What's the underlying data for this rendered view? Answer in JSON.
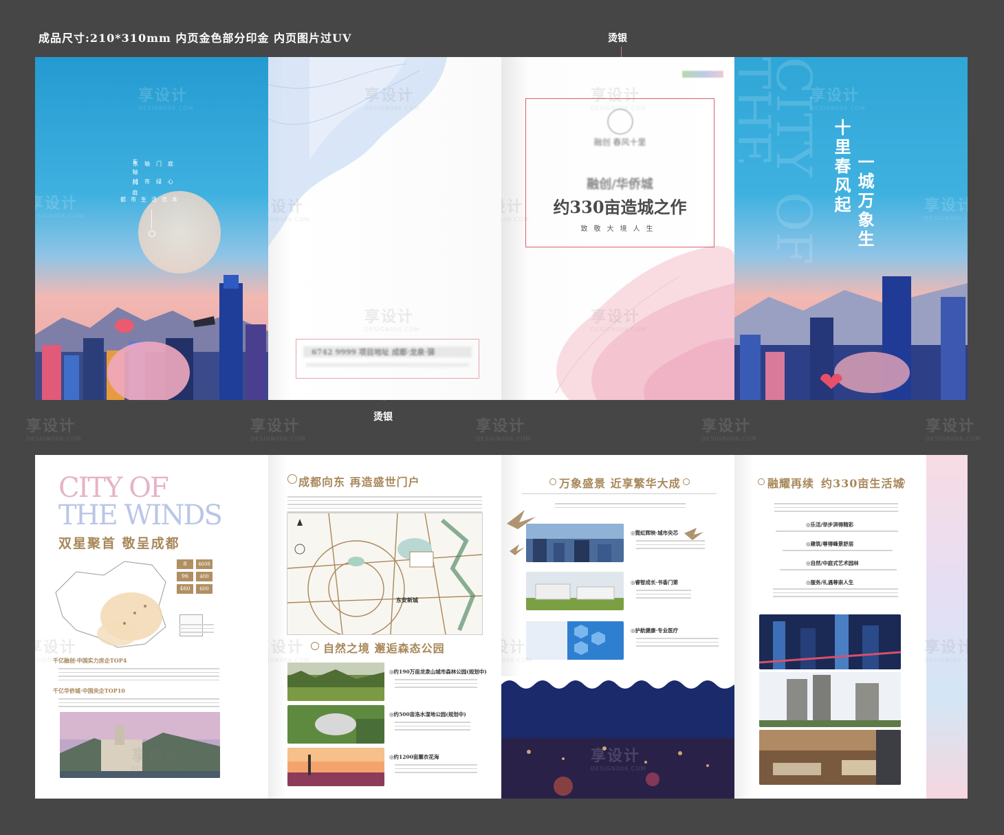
{
  "header": {
    "spec_note": "成品尺寸:210*310mm 内页金色部分印金 内页图片过UV",
    "foil_label_top": "烫银",
    "foil_label_bottom": "烫银"
  },
  "watermark": {
    "text": "享设计",
    "sub": "DESIGN006.COM"
  },
  "cover_left": {
    "lines": [
      "东轴门庭",
      "城市绿心",
      "都市生活范本"
    ]
  },
  "inner_flap": {
    "phone_strip": "6742 9999  项目地址 成都·龙泉·驿"
  },
  "title_page": {
    "brand": "融创 春风十里",
    "developer": "融创/华侨城",
    "headline": "约330亩造城之作",
    "tagline": "致敬大境人生"
  },
  "cover_right": {
    "bg_word": "CITY OF THE WIND",
    "slogan_1": "十里春风起",
    "slogan_2": "一城万象生"
  },
  "page_a": {
    "title_en_1": "CITY OF",
    "title_en_2": "THE WINDS",
    "title_cn": "双星聚首 敬呈成都",
    "stats": [
      "8",
      "4608",
      "96",
      "400",
      "460",
      "600"
    ],
    "item_1": "千亿融创·中国实力房企TOP4",
    "item_2": "千亿华侨城·中国央企TOP10"
  },
  "page_b": {
    "section_1": "成都向东 再造盛世门户",
    "section_2": "自然之境 邂逅森态公园",
    "map_label": "东安新城",
    "park_1": "◎约190万亩龙泉山城市森林公园(规划中)",
    "park_2": "◎约500亩洛水湿地公园(规划中)",
    "park_3": "◎约1200亩薰衣花海"
  },
  "page_c": {
    "title": "万象盛景 近享繁华大成",
    "item_1": "◎霓虹辉映·城市央芯",
    "item_2": "◎睿智成长·书香门第",
    "item_3": "◎护航健康·专业医疗"
  },
  "page_d": {
    "title_a": "融耀再续",
    "title_b": "约330亩生活城",
    "item_1": "◎乐活/举步湃得精彩",
    "item_2": "◎建筑/尊得峰景舒居",
    "item_3": "◎自然/中庭式艺术园林",
    "item_4": "◎服务/礼遇尊崇人生"
  },
  "colors": {
    "background": "#464646",
    "sky_blue": "#2fa6d6",
    "gold": "#a8875a",
    "rose_line": "#d9606c",
    "pink_wave": "#f4c2cf",
    "blue_wave": "#c8dcf2"
  }
}
